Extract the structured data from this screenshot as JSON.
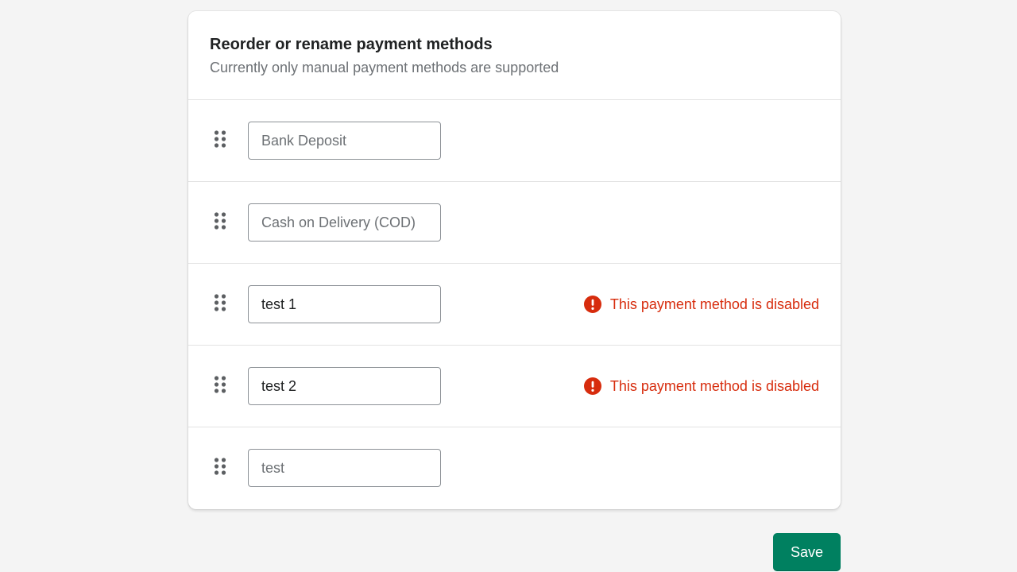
{
  "card": {
    "title": "Reorder or rename payment methods",
    "subtitle": "Currently only manual payment methods are supported"
  },
  "methods": [
    {
      "value": "",
      "placeholder": "Bank Deposit",
      "error": ""
    },
    {
      "value": "",
      "placeholder": "Cash on Delivery (COD)",
      "error": ""
    },
    {
      "value": "test 1",
      "placeholder": "",
      "error": "This payment method is disabled"
    },
    {
      "value": "test 2",
      "placeholder": "",
      "error": "This payment method is disabled"
    },
    {
      "value": "",
      "placeholder": "test",
      "error": ""
    }
  ],
  "icons": {
    "drag": "drag-handle-icon",
    "error": "alert-circle-icon"
  },
  "colors": {
    "primary": "#008060",
    "critical": "#d72c0d",
    "text": "#202223",
    "subdued": "#6d7175"
  },
  "actions": {
    "save_label": "Save"
  }
}
